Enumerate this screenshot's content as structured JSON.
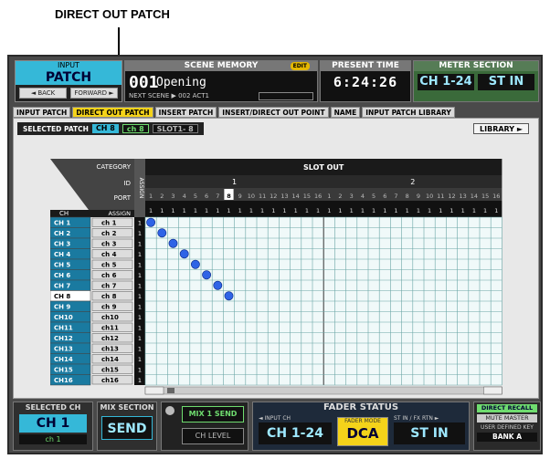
{
  "callout": "DIRECT OUT PATCH",
  "header": {
    "function_label": "INPUT",
    "function_value": "PATCH",
    "back": "◄ BACK",
    "forward": "FORWARD ►",
    "scene_memory_title": "SCENE MEMORY",
    "edit_badge": "EDIT",
    "scene_number": "001",
    "scene_title": "Opening",
    "next_scene": "NEXT SCENE ▶ 002 ACT1",
    "present_time_title": "PRESENT TIME",
    "present_time": "6:24:26",
    "meter_title": "METER SECTION",
    "meter_left": "CH 1-24",
    "meter_right": "ST IN"
  },
  "tabs": [
    "INPUT PATCH",
    "DIRECT OUT PATCH",
    "INSERT PATCH",
    "INSERT/DIRECT OUT POINT",
    "NAME",
    "INPUT PATCH LIBRARY"
  ],
  "active_tab": 1,
  "selected_patch": {
    "label": "SELECTED PATCH",
    "ch": "CH 8",
    "name": "ch 8",
    "slot": "SLOT1- 8"
  },
  "library_button": "LIBRARY ►",
  "matrix": {
    "category": "CATEGORY",
    "id": "ID",
    "port": "PORT",
    "assign": "ASSIGN",
    "ch_header": "CH",
    "assign_vertical": "ASSIGN",
    "slot_out": "SLOT OUT",
    "slot_ids": [
      "1",
      "2"
    ],
    "ports": [
      "1",
      "2",
      "3",
      "4",
      "5",
      "6",
      "7",
      "8",
      "9",
      "10",
      "11",
      "12",
      "13",
      "14",
      "15",
      "16",
      "1",
      "2",
      "3",
      "4",
      "5",
      "6",
      "7",
      "8",
      "9",
      "10",
      "11",
      "12",
      "13",
      "14",
      "15",
      "16"
    ],
    "port_assign_marks": [
      "1",
      "1",
      "1",
      "1",
      "1",
      "1",
      "1",
      "1",
      "1",
      "1",
      "1",
      "1",
      "1",
      "1",
      "1",
      "1",
      "1",
      "1",
      "1",
      "1",
      "1",
      "1",
      "1",
      "1",
      "1",
      "1",
      "1",
      "1",
      "1",
      "1",
      "1",
      "1"
    ],
    "highlight_port": "8",
    "rows": [
      {
        "ch": "CH 1",
        "name": "ch 1",
        "assign": "1"
      },
      {
        "ch": "CH 2",
        "name": "ch 2",
        "assign": "1"
      },
      {
        "ch": "CH 3",
        "name": "ch 3",
        "assign": "1"
      },
      {
        "ch": "CH 4",
        "name": "ch 4",
        "assign": "1"
      },
      {
        "ch": "CH 5",
        "name": "ch 5",
        "assign": "1"
      },
      {
        "ch": "CH 6",
        "name": "ch 6",
        "assign": "1"
      },
      {
        "ch": "CH 7",
        "name": "ch 7",
        "assign": "1"
      },
      {
        "ch": "CH 8",
        "name": "ch 8",
        "assign": "1"
      },
      {
        "ch": "CH 9",
        "name": "ch 9",
        "assign": "1"
      },
      {
        "ch": "CH10",
        "name": "ch10",
        "assign": "1"
      },
      {
        "ch": "CH11",
        "name": "ch11",
        "assign": "1"
      },
      {
        "ch": "CH12",
        "name": "ch12",
        "assign": "1"
      },
      {
        "ch": "CH13",
        "name": "ch13",
        "assign": "1"
      },
      {
        "ch": "CH14",
        "name": "ch14",
        "assign": "1"
      },
      {
        "ch": "CH15",
        "name": "ch15",
        "assign": "1"
      },
      {
        "ch": "CH16",
        "name": "ch16",
        "assign": "1"
      }
    ],
    "selected_row": "CH 8",
    "patched": [
      [
        1,
        1
      ],
      [
        2,
        2
      ],
      [
        3,
        3
      ],
      [
        4,
        4
      ],
      [
        5,
        5
      ],
      [
        6,
        6
      ],
      [
        7,
        7
      ],
      [
        8,
        8
      ]
    ]
  },
  "bottom": {
    "selected_ch_label": "SELECTED CH",
    "selected_ch": "CH 1",
    "selected_ch_name": "ch 1",
    "mix_section_label": "MIX SECTION",
    "mix_section": "SEND",
    "mix1_send": "MIX 1 SEND",
    "ch_level": "CH LEVEL",
    "fader_status": "FADER STATUS",
    "input_ch_label": "◄ INPUT CH",
    "input_ch": "CH 1-24",
    "fader_mode_label": "FADER MODE",
    "fader_mode": "DCA",
    "st_in_label": "ST IN / FX RTN ►",
    "st_in": "ST IN",
    "direct_recall": "DIRECT RECALL",
    "mute_master": "MUTE MASTER",
    "user_defined_key": "USER DEFINED KEY",
    "bank": "BANK A"
  }
}
